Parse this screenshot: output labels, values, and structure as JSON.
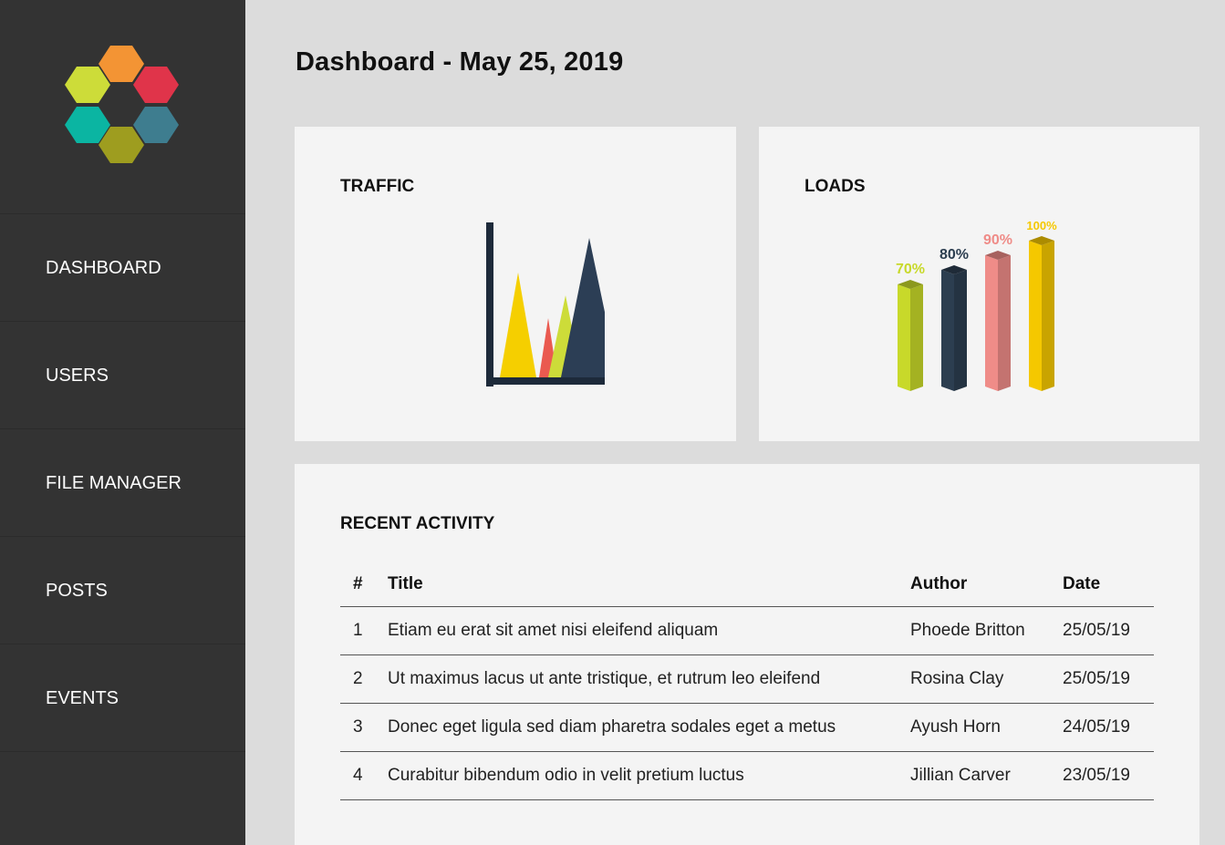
{
  "sidebar": {
    "items": [
      {
        "label": "DASHBOARD"
      },
      {
        "label": "USERS"
      },
      {
        "label": "FILE MANAGER"
      },
      {
        "label": "POSTS"
      },
      {
        "label": "EVENTS"
      }
    ]
  },
  "main": {
    "title": "Dashboard - May 25, 2019"
  },
  "traffic": {
    "title": "TRAFFIC"
  },
  "loads": {
    "title": "LOADS",
    "bars": [
      {
        "label": "70%",
        "value": 70,
        "color": "#c8d92a"
      },
      {
        "label": "80%",
        "value": 80,
        "color": "#2c3e50"
      },
      {
        "label": "90%",
        "value": 90,
        "color": "#ef8c88"
      },
      {
        "label": "100%",
        "value": 100,
        "color": "#f5c800"
      }
    ]
  },
  "activity": {
    "title": "RECENT ACTIVITY",
    "headers": {
      "num": "#",
      "title": "Title",
      "author": "Author",
      "date": "Date"
    },
    "rows": [
      {
        "num": "1",
        "title": "Etiam eu erat sit amet nisi eleifend aliquam",
        "author": "Phoede Britton",
        "date": "25/05/19"
      },
      {
        "num": "2",
        "title": "Ut maximus lacus ut ante tristique, et rutrum leo eleifend",
        "author": "Rosina Clay",
        "date": "25/05/19"
      },
      {
        "num": "3",
        "title": "Donec eget ligula sed diam pharetra sodales eget a metus",
        "author": "Ayush Horn",
        "date": "24/05/19"
      },
      {
        "num": "4",
        "title": "Curabitur bibendum odio in velit pretium luctus",
        "author": "Jillian Carver",
        "date": "23/05/19"
      }
    ]
  },
  "colors": {
    "sidebar_bg": "#333333",
    "page_bg": "#dcdcdc",
    "card_bg": "#f4f4f4"
  }
}
